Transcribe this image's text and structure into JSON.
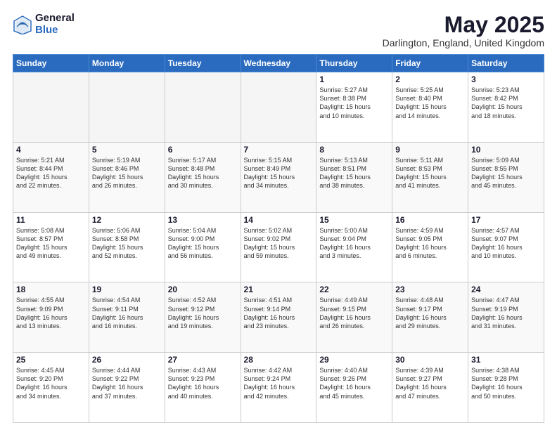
{
  "logo": {
    "general": "General",
    "blue": "Blue"
  },
  "header": {
    "title": "May 2025",
    "subtitle": "Darlington, England, United Kingdom"
  },
  "weekdays": [
    "Sunday",
    "Monday",
    "Tuesday",
    "Wednesday",
    "Thursday",
    "Friday",
    "Saturday"
  ],
  "weeks": [
    [
      {
        "day": "",
        "info": ""
      },
      {
        "day": "",
        "info": ""
      },
      {
        "day": "",
        "info": ""
      },
      {
        "day": "",
        "info": ""
      },
      {
        "day": "1",
        "info": "Sunrise: 5:27 AM\nSunset: 8:38 PM\nDaylight: 15 hours\nand 10 minutes."
      },
      {
        "day": "2",
        "info": "Sunrise: 5:25 AM\nSunset: 8:40 PM\nDaylight: 15 hours\nand 14 minutes."
      },
      {
        "day": "3",
        "info": "Sunrise: 5:23 AM\nSunset: 8:42 PM\nDaylight: 15 hours\nand 18 minutes."
      }
    ],
    [
      {
        "day": "4",
        "info": "Sunrise: 5:21 AM\nSunset: 8:44 PM\nDaylight: 15 hours\nand 22 minutes."
      },
      {
        "day": "5",
        "info": "Sunrise: 5:19 AM\nSunset: 8:46 PM\nDaylight: 15 hours\nand 26 minutes."
      },
      {
        "day": "6",
        "info": "Sunrise: 5:17 AM\nSunset: 8:48 PM\nDaylight: 15 hours\nand 30 minutes."
      },
      {
        "day": "7",
        "info": "Sunrise: 5:15 AM\nSunset: 8:49 PM\nDaylight: 15 hours\nand 34 minutes."
      },
      {
        "day": "8",
        "info": "Sunrise: 5:13 AM\nSunset: 8:51 PM\nDaylight: 15 hours\nand 38 minutes."
      },
      {
        "day": "9",
        "info": "Sunrise: 5:11 AM\nSunset: 8:53 PM\nDaylight: 15 hours\nand 41 minutes."
      },
      {
        "day": "10",
        "info": "Sunrise: 5:09 AM\nSunset: 8:55 PM\nDaylight: 15 hours\nand 45 minutes."
      }
    ],
    [
      {
        "day": "11",
        "info": "Sunrise: 5:08 AM\nSunset: 8:57 PM\nDaylight: 15 hours\nand 49 minutes."
      },
      {
        "day": "12",
        "info": "Sunrise: 5:06 AM\nSunset: 8:58 PM\nDaylight: 15 hours\nand 52 minutes."
      },
      {
        "day": "13",
        "info": "Sunrise: 5:04 AM\nSunset: 9:00 PM\nDaylight: 15 hours\nand 56 minutes."
      },
      {
        "day": "14",
        "info": "Sunrise: 5:02 AM\nSunset: 9:02 PM\nDaylight: 15 hours\nand 59 minutes."
      },
      {
        "day": "15",
        "info": "Sunrise: 5:00 AM\nSunset: 9:04 PM\nDaylight: 16 hours\nand 3 minutes."
      },
      {
        "day": "16",
        "info": "Sunrise: 4:59 AM\nSunset: 9:05 PM\nDaylight: 16 hours\nand 6 minutes."
      },
      {
        "day": "17",
        "info": "Sunrise: 4:57 AM\nSunset: 9:07 PM\nDaylight: 16 hours\nand 10 minutes."
      }
    ],
    [
      {
        "day": "18",
        "info": "Sunrise: 4:55 AM\nSunset: 9:09 PM\nDaylight: 16 hours\nand 13 minutes."
      },
      {
        "day": "19",
        "info": "Sunrise: 4:54 AM\nSunset: 9:11 PM\nDaylight: 16 hours\nand 16 minutes."
      },
      {
        "day": "20",
        "info": "Sunrise: 4:52 AM\nSunset: 9:12 PM\nDaylight: 16 hours\nand 19 minutes."
      },
      {
        "day": "21",
        "info": "Sunrise: 4:51 AM\nSunset: 9:14 PM\nDaylight: 16 hours\nand 23 minutes."
      },
      {
        "day": "22",
        "info": "Sunrise: 4:49 AM\nSunset: 9:15 PM\nDaylight: 16 hours\nand 26 minutes."
      },
      {
        "day": "23",
        "info": "Sunrise: 4:48 AM\nSunset: 9:17 PM\nDaylight: 16 hours\nand 29 minutes."
      },
      {
        "day": "24",
        "info": "Sunrise: 4:47 AM\nSunset: 9:19 PM\nDaylight: 16 hours\nand 31 minutes."
      }
    ],
    [
      {
        "day": "25",
        "info": "Sunrise: 4:45 AM\nSunset: 9:20 PM\nDaylight: 16 hours\nand 34 minutes."
      },
      {
        "day": "26",
        "info": "Sunrise: 4:44 AM\nSunset: 9:22 PM\nDaylight: 16 hours\nand 37 minutes."
      },
      {
        "day": "27",
        "info": "Sunrise: 4:43 AM\nSunset: 9:23 PM\nDaylight: 16 hours\nand 40 minutes."
      },
      {
        "day": "28",
        "info": "Sunrise: 4:42 AM\nSunset: 9:24 PM\nDaylight: 16 hours\nand 42 minutes."
      },
      {
        "day": "29",
        "info": "Sunrise: 4:40 AM\nSunset: 9:26 PM\nDaylight: 16 hours\nand 45 minutes."
      },
      {
        "day": "30",
        "info": "Sunrise: 4:39 AM\nSunset: 9:27 PM\nDaylight: 16 hours\nand 47 minutes."
      },
      {
        "day": "31",
        "info": "Sunrise: 4:38 AM\nSunset: 9:28 PM\nDaylight: 16 hours\nand 50 minutes."
      }
    ]
  ]
}
